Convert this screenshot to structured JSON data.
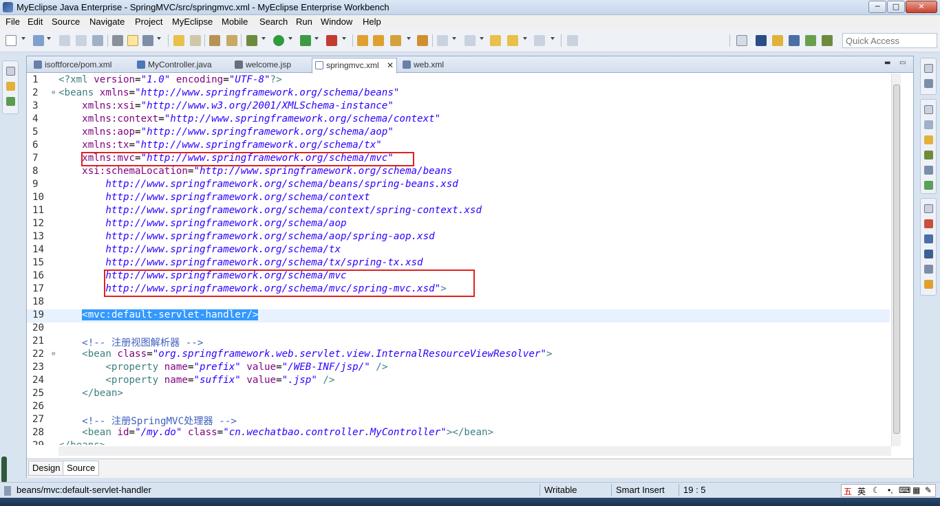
{
  "window": {
    "title": "MyEclipse Java Enterprise - SpringMVC/src/springmvc.xml - MyEclipse Enterprise Workbench",
    "buttons": [
      "─",
      "□",
      "✕"
    ]
  },
  "menu": [
    "File",
    "Edit",
    "Source",
    "Navigate",
    "Project",
    "MyEclipse",
    "Mobile",
    "Search",
    "Run",
    "Window",
    "Help"
  ],
  "quick_access": {
    "placeholder": "Quick Access"
  },
  "tabs": [
    {
      "label": "isoftforce/pom.xml",
      "icon": "xml-file-icon",
      "active": false
    },
    {
      "label": "MyController.java",
      "icon": "java-file-icon",
      "active": false
    },
    {
      "label": "welcome.jsp",
      "icon": "jsp-file-icon",
      "active": false
    },
    {
      "label": "springmvc.xml",
      "icon": "xml-file-icon",
      "active": true,
      "close": "✕"
    },
    {
      "label": "web.xml",
      "icon": "xml-file-icon",
      "active": false
    }
  ],
  "code": {
    "selected_line": 19,
    "lines": [
      {
        "n": "1",
        "fold": "",
        "parts": [
          [
            "pi",
            "<?xml "
          ],
          [
            "attr",
            "version"
          ],
          [
            "plain",
            "="
          ],
          [
            "str",
            "\"1.0\""
          ],
          [
            "plain",
            " "
          ],
          [
            "attr",
            "encoding"
          ],
          [
            "plain",
            "="
          ],
          [
            "str",
            "\"UTF-8\""
          ],
          [
            "pi",
            "?>"
          ]
        ]
      },
      {
        "n": "2",
        "fold": "⊖",
        "parts": [
          [
            "tag",
            "<beans "
          ],
          [
            "attr",
            "xmlns"
          ],
          [
            "plain",
            "="
          ],
          [
            "str",
            "\"http://www.springframework.org/schema/beans\""
          ]
        ]
      },
      {
        "n": "3",
        "fold": "",
        "parts": [
          [
            "plain",
            "    "
          ],
          [
            "attr",
            "xmlns:xsi"
          ],
          [
            "plain",
            "="
          ],
          [
            "str",
            "\"http://www.w3.org/2001/XMLSchema-instance\""
          ]
        ]
      },
      {
        "n": "4",
        "fold": "",
        "parts": [
          [
            "plain",
            "    "
          ],
          [
            "attr",
            "xmlns:context"
          ],
          [
            "plain",
            "="
          ],
          [
            "str",
            "\"http://www.springframework.org/schema/context\""
          ]
        ]
      },
      {
        "n": "5",
        "fold": "",
        "parts": [
          [
            "plain",
            "    "
          ],
          [
            "attr",
            "xmlns:aop"
          ],
          [
            "plain",
            "="
          ],
          [
            "str",
            "\"http://www.springframework.org/schema/aop\""
          ]
        ]
      },
      {
        "n": "6",
        "fold": "",
        "parts": [
          [
            "plain",
            "    "
          ],
          [
            "attr",
            "xmlns:tx"
          ],
          [
            "plain",
            "="
          ],
          [
            "str",
            "\"http://www.springframework.org/schema/tx\""
          ]
        ]
      },
      {
        "n": "7",
        "fold": "",
        "parts": [
          [
            "plain",
            "    "
          ],
          [
            "attr",
            "xmlns:mvc"
          ],
          [
            "plain",
            "="
          ],
          [
            "str",
            "\"http://www.springframework.org/schema/mvc\""
          ]
        ]
      },
      {
        "n": "8",
        "fold": "",
        "parts": [
          [
            "plain",
            "    "
          ],
          [
            "attr",
            "xsi:schemaLocation"
          ],
          [
            "plain",
            "="
          ],
          [
            "str",
            "\"http://www.springframework.org/schema/beans"
          ]
        ]
      },
      {
        "n": "9",
        "fold": "",
        "parts": [
          [
            "plain",
            "        "
          ],
          [
            "str",
            "http://www.springframework.org/schema/beans/spring-beans.xsd"
          ]
        ]
      },
      {
        "n": "10",
        "fold": "",
        "parts": [
          [
            "plain",
            "        "
          ],
          [
            "str",
            "http://www.springframework.org/schema/context"
          ]
        ]
      },
      {
        "n": "11",
        "fold": "",
        "parts": [
          [
            "plain",
            "        "
          ],
          [
            "str",
            "http://www.springframework.org/schema/context/spring-context.xsd"
          ]
        ]
      },
      {
        "n": "12",
        "fold": "",
        "parts": [
          [
            "plain",
            "        "
          ],
          [
            "str",
            "http://www.springframework.org/schema/aop"
          ]
        ]
      },
      {
        "n": "13",
        "fold": "",
        "parts": [
          [
            "plain",
            "        "
          ],
          [
            "str",
            "http://www.springframework.org/schema/aop/spring-aop.xsd"
          ]
        ]
      },
      {
        "n": "14",
        "fold": "",
        "parts": [
          [
            "plain",
            "        "
          ],
          [
            "str",
            "http://www.springframework.org/schema/tx"
          ]
        ]
      },
      {
        "n": "15",
        "fold": "",
        "parts": [
          [
            "plain",
            "        "
          ],
          [
            "str",
            "http://www.springframework.org/schema/tx/spring-tx.xsd"
          ]
        ]
      },
      {
        "n": "16",
        "fold": "",
        "parts": [
          [
            "plain",
            "        "
          ],
          [
            "str",
            "http://www.springframework.org/schema/mvc"
          ]
        ]
      },
      {
        "n": "17",
        "fold": "",
        "parts": [
          [
            "plain",
            "        "
          ],
          [
            "str",
            "http://www.springframework.org/schema/mvc/spring-mvc.xsd\""
          ],
          [
            "tag",
            ">"
          ]
        ]
      },
      {
        "n": "18",
        "fold": "",
        "parts": []
      },
      {
        "n": "19",
        "fold": "",
        "parts": [
          [
            "plain",
            "    "
          ],
          [
            "sel",
            "<mvc:default-servlet-handler/>"
          ]
        ]
      },
      {
        "n": "20",
        "fold": "",
        "parts": []
      },
      {
        "n": "21",
        "fold": "",
        "parts": [
          [
            "plain",
            "    "
          ],
          [
            "cmt",
            "<!-- 注册视图解析器 -->"
          ]
        ]
      },
      {
        "n": "22",
        "fold": "⊖",
        "parts": [
          [
            "plain",
            "    "
          ],
          [
            "tag",
            "<bean "
          ],
          [
            "attr",
            "class"
          ],
          [
            "plain",
            "="
          ],
          [
            "str",
            "\"org.springframework.web.servlet.view.InternalResourceViewResolver\""
          ],
          [
            "tag",
            ">"
          ]
        ]
      },
      {
        "n": "23",
        "fold": "",
        "parts": [
          [
            "plain",
            "        "
          ],
          [
            "tag",
            "<property "
          ],
          [
            "attr",
            "name"
          ],
          [
            "plain",
            "="
          ],
          [
            "str",
            "\"prefix\""
          ],
          [
            "plain",
            " "
          ],
          [
            "attr",
            "value"
          ],
          [
            "plain",
            "="
          ],
          [
            "str",
            "\"/WEB-INF/jsp/\""
          ],
          [
            "tag",
            " />"
          ]
        ]
      },
      {
        "n": "24",
        "fold": "",
        "parts": [
          [
            "plain",
            "        "
          ],
          [
            "tag",
            "<property "
          ],
          [
            "attr",
            "name"
          ],
          [
            "plain",
            "="
          ],
          [
            "str",
            "\"suffix\""
          ],
          [
            "plain",
            " "
          ],
          [
            "attr",
            "value"
          ],
          [
            "plain",
            "="
          ],
          [
            "str",
            "\".jsp\""
          ],
          [
            "tag",
            " />"
          ]
        ]
      },
      {
        "n": "25",
        "fold": "",
        "parts": [
          [
            "plain",
            "    "
          ],
          [
            "tag",
            "</bean>"
          ]
        ]
      },
      {
        "n": "26",
        "fold": "",
        "parts": []
      },
      {
        "n": "27",
        "fold": "",
        "parts": [
          [
            "plain",
            "    "
          ],
          [
            "cmt",
            "<!-- 注册SpringMVC处理器 -->"
          ]
        ]
      },
      {
        "n": "28",
        "fold": "",
        "parts": [
          [
            "plain",
            "    "
          ],
          [
            "tag",
            "<bean "
          ],
          [
            "attr",
            "id"
          ],
          [
            "plain",
            "="
          ],
          [
            "str",
            "\"/my.do\""
          ],
          [
            "plain",
            " "
          ],
          [
            "attr",
            "class"
          ],
          [
            "plain",
            "="
          ],
          [
            "str",
            "\"cn.wechatbao.controller.MyController\""
          ],
          [
            "tag",
            "></bean>"
          ]
        ]
      },
      {
        "n": "29",
        "fold": "",
        "parts": [
          [
            "tag",
            "</beans>"
          ]
        ]
      }
    ]
  },
  "editor_tabs": [
    "Design",
    "Source"
  ],
  "status": {
    "path": "beans/mvc:default-servlet-handler",
    "mode": "Writable",
    "insert": "Smart Insert",
    "position": "19 : 5"
  },
  "ime": [
    "五",
    "英"
  ]
}
